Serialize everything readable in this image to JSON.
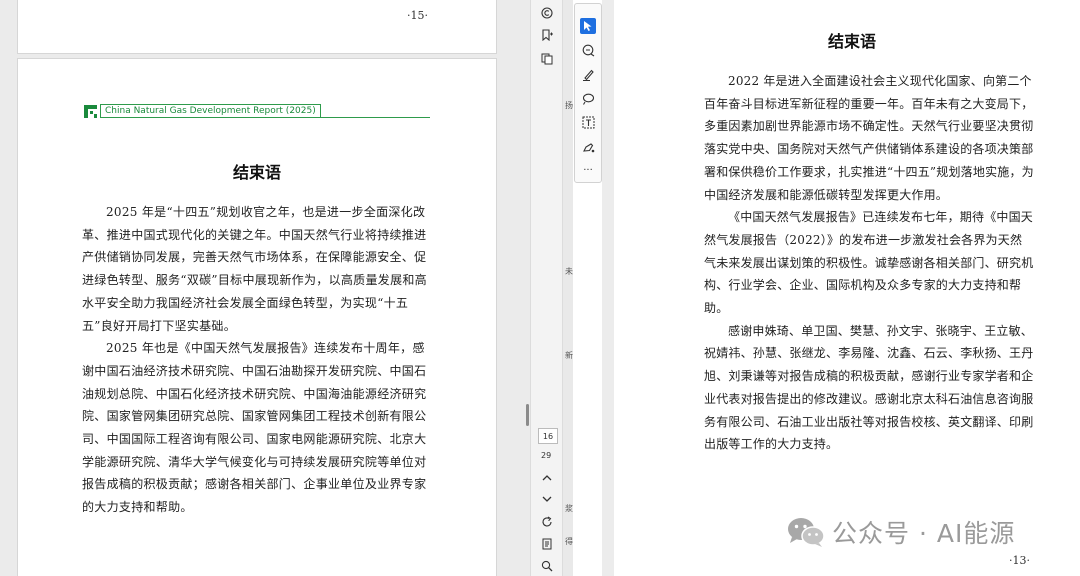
{
  "left_viewer": {
    "prev_page_number": "·15·",
    "report_title": "China Natural Gas Development Report (2025)",
    "heading": "结束语",
    "paragraphs": [
      "2025 年是“十四五”规划收官之年，也是进一步全面深化改革、推进中国式现代化的关键之年。中国天然气行业将持续推进产供储销协同发展，完善天然气市场体系，在保障能源安全、促进绿色转型、服务“双碳”目标中展现新作为，以高质量发展和高水平安全助力我国经济社会发展全面绿色转型，为实现“十五五”良好开局打下坚实基础。",
      "2025 年也是《中国天然气发展报告》连续发布十周年，感谢中国石油经济技术研究院、中国石油勘探开发研究院、中国石油规划总院、中国石化经济技术研究院、中国海油能源经济研究院、国家管网集团研究总院、国家管网集团工程技术创新有限公司、中国国际工程咨询有限公司、国家电网能源研究院、北京大学能源研究院、清华大学气候变化与可持续发展研究院等单位对报告成稿的积极贡献；感谢各相关部门、企事业单位及业界专家的大力支持和帮助。"
    ]
  },
  "mid_toolbar": {
    "current_page": "16",
    "total_pages": "29",
    "icons": [
      "copyright-icon",
      "bookmark-icon",
      "copy-pages-icon",
      "chevron-up-icon",
      "chevron-down-icon",
      "rotate-icon",
      "page-export-icon",
      "zoom-icon"
    ]
  },
  "peek_chars": [
    "扬",
    "未",
    "新",
    "浆",
    "得"
  ],
  "annotation_toolbar": {
    "tools": [
      "select-tool",
      "comment-tool",
      "highlight-pen-tool",
      "shape-tool",
      "text-box-tool",
      "stamp-tool",
      "more-tools"
    ],
    "more_label": "···"
  },
  "right_page": {
    "heading": "结束语",
    "page_number": "·13·",
    "paragraphs": [
      "2022 年是进入全面建设社会主义现代化国家、向第二个百年奋斗目标进军新征程的重要一年。百年未有之大变局下，多重因素加剧世界能源市场不确定性。天然气行业要坚决贯彻落实党中央、国务院对天然气产供储销体系建设的各项决策部署和保供稳价工作要求，扎实推进“十四五”规划落地实施，为中国经济发展和能源低碳转型发挥更大作用。",
      "《中国天然气发展报告》已连续发布七年，期待《中国天然气发展报告（2022）》的发布进一步激发社会各界为天然气未来发展出谋划策的积极性。诚挚感谢各相关部门、研究机构、行业学会、企业、国际机构及众多专家的大力支持和帮助。",
      "感谢申姝琦、单卫国、樊慧、孙文宇、张晓宇、王立敏、祝婧祎、孙慧、张继龙、李易隆、沈鑫、石云、李秋扬、王丹旭、刘秉谦等对报告成稿的积极贡献，感谢行业专家学者和企业代表对报告提出的修改建议。感谢北京太科石油信息咨询服务有限公司、石油工业出版社等对报告校核、英文翻译、印刷出版等工作的大力支持。"
    ]
  },
  "watermark": {
    "text": "公众号 · AI能源"
  },
  "colors": {
    "accent_blue": "#1e6fe0",
    "report_green": "#1a8a3c",
    "watermark_gray": "#9a9a9a"
  }
}
